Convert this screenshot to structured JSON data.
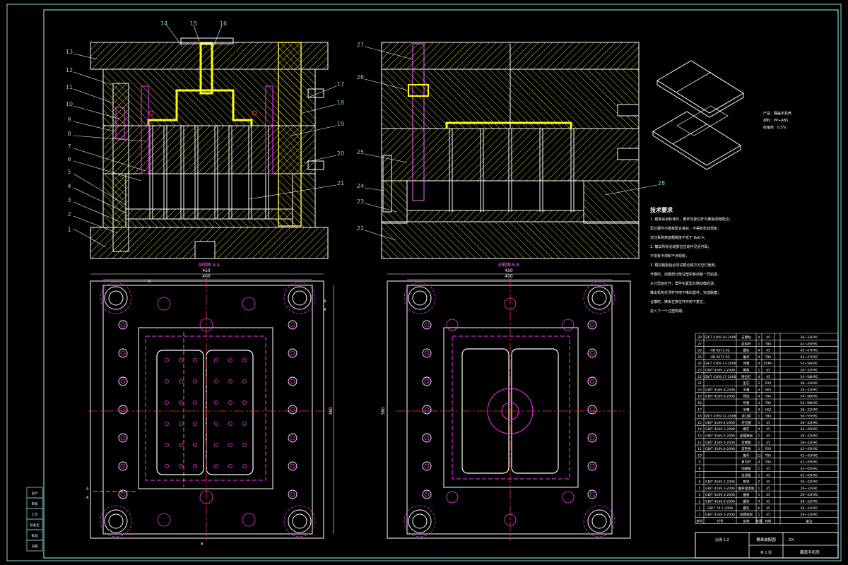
{
  "colors": {
    "background": "#000000",
    "frame": "#7fd6d6",
    "outline": "#ffffff",
    "hatch": "#f2e94e",
    "cavity": "#ffff00",
    "center_lines": "#ff2d2d",
    "hidden_lines": "#ff33ff",
    "leader": "#ffffff",
    "part_numbers": "#7fd6d6",
    "dimensions": "#ffffff",
    "product": "#ffffff"
  },
  "left_section": {
    "label": "剖视图 A-A",
    "callouts": [
      "1",
      "2",
      "3",
      "4",
      "5",
      "6",
      "7",
      "8",
      "9",
      "10",
      "11",
      "12",
      "13",
      "14",
      "15",
      "16",
      "17",
      "18",
      "19",
      "20",
      "21"
    ]
  },
  "right_section": {
    "label": "剖视图 B-B",
    "callouts": [
      "22",
      "23",
      "24",
      "25",
      "26",
      "27",
      "28"
    ]
  },
  "left_plan": {
    "overall_width": "450",
    "plate_width": "400",
    "height_label": "380",
    "section_letters": [
      "A",
      "A",
      "B",
      "B",
      "A",
      "A"
    ]
  },
  "right_plan": {
    "overall_width": "450",
    "plate_width": "400",
    "height_label": "380"
  },
  "product_note": {
    "lines": [
      "产品：翻盖手机壳",
      "材料：PP+ABS",
      "收缩率：0.5%"
    ]
  },
  "tech_requirements": {
    "title": "技术要求",
    "lines": [
      "1. 模架采用标准件，推杆及复位杆与推板间隙配合；",
      "    型芯镶件与模板配合良好，不得有松动现象；",
      "    浇注系统表面粗糙度不低于 Ra0.4；",
      "2. 模具所有活动部位应动作灵活可靠；",
      "    不得有卡滞和干涉现象；",
      "3. 模具装配后必须试模合格方可交付使用。",
      "    开模时，动模部分随注塑机移动板一同后退，",
      "    主分型面打开，塑件包紧型芯随动模后退；",
      "    推出机构在顶杆作用下推出塑件，完成脱模；",
      "    合模时，推板在复位杆作用下复位，",
      "    进入下一个注塑周期。"
    ]
  },
  "bom": {
    "rows": [
      {
        "no": "28",
        "std": "GB/T 4169.10-2006",
        "name": "支撑柱",
        "qty": "4",
        "mat": "45",
        "note": "28~32HRC"
      },
      {
        "no": "27",
        "std": "",
        "name": "拉料杆",
        "qty": "1",
        "mat": "T8A",
        "note": "42~45HRC"
      },
      {
        "no": "26",
        "std": "HB 4571-92",
        "name": "螺钉",
        "qty": "4",
        "mat": "45",
        "note": "42~47HRC"
      },
      {
        "no": "25",
        "std": "HB 4571-92",
        "name": "推杆",
        "qty": "4",
        "mat": "T8A",
        "note": "42~47HRC"
      },
      {
        "no": "24",
        "std": "GB/T 4169.13-2006",
        "name": "弹簧",
        "qty": "4",
        "mat": "65Mn",
        "note": "54~58HRC"
      },
      {
        "no": "23",
        "std": "GB/T 4169.1-2006",
        "name": "推板",
        "qty": "1",
        "mat": "45",
        "note": "28~32HRC"
      },
      {
        "no": "22",
        "std": "GB/T 4169.17-2006",
        "name": "限位钉",
        "qty": "4",
        "mat": "45",
        "note": "54~58HRC"
      },
      {
        "no": "21",
        "std": "",
        "name": "型芯",
        "qty": "2",
        "mat": "P20",
        "note": "28~32HRC"
      },
      {
        "no": "20",
        "std": "GB/T 4169.8-2006",
        "name": "水嘴",
        "qty": "4",
        "mat": "H62",
        "note": "28~32HRC"
      },
      {
        "no": "19",
        "std": "GB/T 4169.6-2006",
        "name": "导柱",
        "qty": "4",
        "mat": "T8A",
        "note": "54~58HRC"
      },
      {
        "no": "18",
        "std": "",
        "name": "导套",
        "qty": "4",
        "mat": "T8A",
        "note": "54~58HRC"
      },
      {
        "no": "17",
        "std": "",
        "name": "水嘴",
        "qty": "4",
        "mat": "H62",
        "note": "28~32HRC"
      },
      {
        "no": "16",
        "std": "GB/T 4169.12-2006",
        "name": "浇口套",
        "qty": "1",
        "mat": "T8A",
        "note": "50~55HRC"
      },
      {
        "no": "15",
        "std": "GB/T 4169.4-2006",
        "name": "定位圈",
        "qty": "1",
        "mat": "45",
        "note": "28~32HRC"
      },
      {
        "no": "14",
        "std": "GB/T 4169.3-2006",
        "name": "螺钉",
        "qty": "4",
        "mat": "45",
        "note": "42~45HRC"
      },
      {
        "no": "13",
        "std": "GB/T 4169.5-2006",
        "name": "定模座板",
        "qty": "1",
        "mat": "45",
        "note": "28~32HRC"
      },
      {
        "no": "12",
        "std": "GB/T 4169.5-2006",
        "name": "定模板",
        "qty": "1",
        "mat": "45",
        "note": "28~32HRC"
      },
      {
        "no": "11",
        "std": "GB/T 4169.8-2006",
        "name": "型腔板",
        "qty": "1",
        "mat": "P20",
        "note": "42~45HRC"
      },
      {
        "no": "10",
        "std": "",
        "name": "推杆",
        "qty": "12",
        "mat": "T8A",
        "note": "42~45HRC"
      },
      {
        "no": "9",
        "std": "",
        "name": "复位杆",
        "qty": "4",
        "mat": "T8A",
        "note": "42~45HRC"
      },
      {
        "no": "8",
        "std": "",
        "name": "动模板",
        "qty": "1",
        "mat": "45",
        "note": "42~45HRC"
      },
      {
        "no": "7",
        "std": "",
        "name": "支承板",
        "qty": "1",
        "mat": "45",
        "note": "42~45HRC"
      },
      {
        "no": "6",
        "std": "GB/T 4169.1-2006",
        "name": "垫块",
        "qty": "2",
        "mat": "45",
        "note": "28~32HRC"
      },
      {
        "no": "5",
        "std": "GB/T 4169.3-2006",
        "name": "推杆固定板",
        "qty": "1",
        "mat": "45",
        "note": "28~32HRC"
      },
      {
        "no": "4",
        "std": "GB/T 4169.3-2006",
        "name": "推板",
        "qty": "1",
        "mat": "45",
        "note": "28~32HRC"
      },
      {
        "no": "3",
        "std": "GB/T 4169.8-2006",
        "name": "螺钉",
        "qty": "4",
        "mat": "45",
        "note": "28~32HRC"
      },
      {
        "no": "2",
        "std": "GB/T 70.1-2000",
        "name": "螺钉",
        "qty": "6",
        "mat": "45",
        "note": "28~32HRC"
      },
      {
        "no": "1",
        "std": "GB/T 4169.5-2006",
        "name": "动模座板",
        "qty": "1",
        "mat": "45",
        "note": "28~32HRC"
      }
    ],
    "header": {
      "no": "序号",
      "std": "代号",
      "name": "名称",
      "qty": "数量",
      "mat": "材料",
      "note": "备注"
    }
  },
  "title_block": {
    "part_name": "模具装配图",
    "drawing_no": "ZX",
    "product_name": "翻盖手机壳",
    "scale_label": "比例 1:2",
    "sheet_label": "共 1 张"
  },
  "left_strip": {
    "items": [
      "设计",
      "审核",
      "工艺",
      "标准化",
      "批准",
      "日期"
    ]
  }
}
